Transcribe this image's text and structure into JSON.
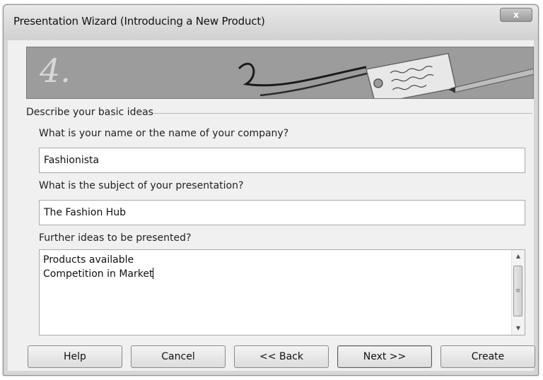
{
  "window": {
    "title": "Presentation Wizard (Introducing a New Product)",
    "close_label": "x"
  },
  "banner": {
    "step_number": "4."
  },
  "group": {
    "label": "Describe your basic ideas"
  },
  "fields": {
    "name_label": "What is your name or the name of your company?",
    "name_value": "Fashionista",
    "subject_label": "What is the subject of your presentation?",
    "subject_value": "The Fashion Hub",
    "ideas_label": "Further ideas to be presented?",
    "ideas_lines": [
      "Products available",
      "Competition in Market"
    ]
  },
  "buttons": {
    "help": "Help",
    "cancel": "Cancel",
    "back": "<< Back",
    "next": "Next >>",
    "create": "Create"
  },
  "icons": {
    "scroll_up": "scroll-up-arrow-icon",
    "scroll_down": "scroll-down-arrow-icon",
    "thumb_grip": "scroll-grip-icon"
  }
}
